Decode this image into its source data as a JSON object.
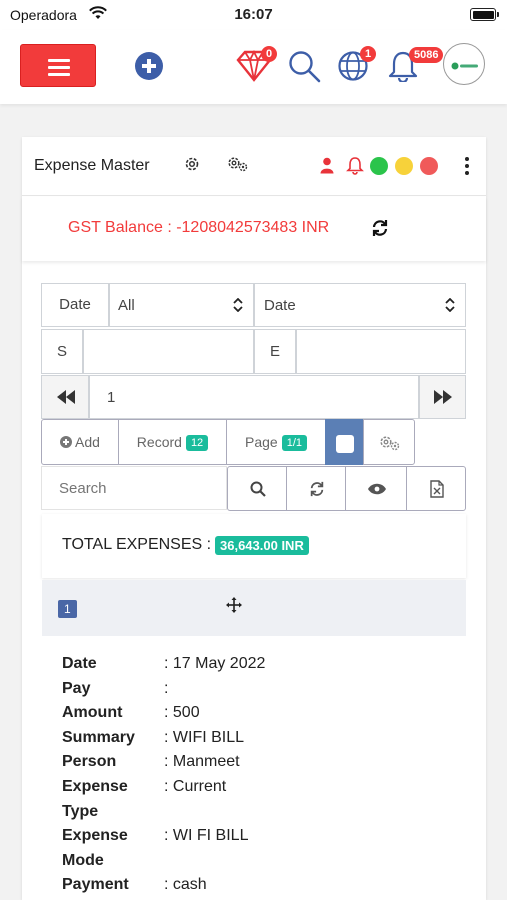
{
  "status": {
    "carrier": "Operadora",
    "time": "16:07"
  },
  "nav": {
    "diamond_badge": "0",
    "globe_badge": "1",
    "bell_badge": "5086"
  },
  "card": {
    "title": "Expense Master",
    "status_dots": [
      "#2bc44b",
      "#f7d23a",
      "#f05a5a"
    ]
  },
  "gst": {
    "text": "GST Balance : -1208042573483 INR"
  },
  "filters": {
    "date_label": "Date",
    "type_select": "All",
    "date_select": "Date",
    "start_label": "S",
    "end_label": "E",
    "start_value": "",
    "end_value": "",
    "page_input": "1"
  },
  "toolbar": {
    "add_label": "Add",
    "record_label": "Record",
    "record_count": "12",
    "page_label": "Page",
    "page_count": "1/1"
  },
  "search": {
    "placeholder": "Search"
  },
  "totals": {
    "label": "TOTAL EXPENSES :",
    "value": "36,643.00 INR"
  },
  "record": {
    "number": "1",
    "fields": [
      {
        "key": "Date",
        "value": ": 17 May 2022"
      },
      {
        "key": "Pay",
        "value": ":"
      },
      {
        "key": "Amount",
        "value": ": 500"
      },
      {
        "key": "Summary",
        "value": ": WIFI BILL"
      },
      {
        "key": "Person",
        "value": ": Manmeet"
      },
      {
        "key": "Expense",
        "value": ": Current"
      },
      {
        "key": "Type",
        "value": ""
      },
      {
        "key": "Expense",
        "value": ": WI FI BILL"
      },
      {
        "key": "Mode",
        "value": ""
      },
      {
        "key": "Payment",
        "value": ": cash"
      }
    ]
  }
}
